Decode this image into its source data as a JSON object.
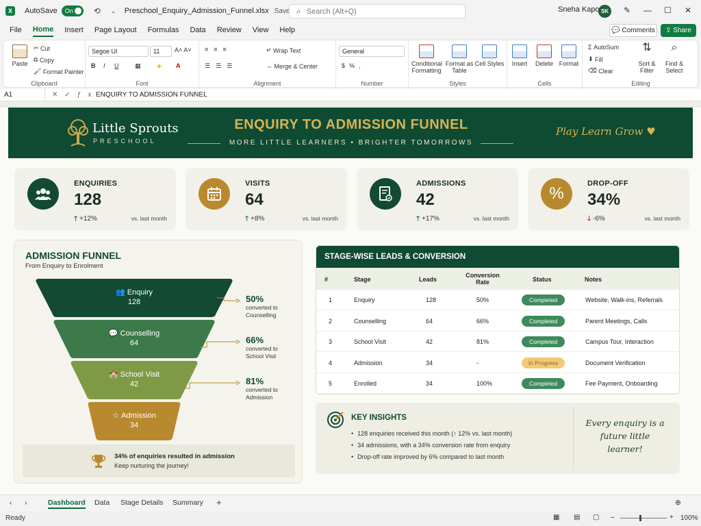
{
  "titlebar": {
    "autosave_label": "AutoSave",
    "autosave_state": "On",
    "filename": "Preschool_Enquiry_Admission_Funnel.xlsx",
    "saved_status": "Saved to OneDrive",
    "search_placeholder": "Search (Alt+Q)",
    "user_name": "Sneha Kapoor",
    "user_initials": "SK"
  },
  "menu": {
    "items": [
      "File",
      "Home",
      "Insert",
      "Page Layout",
      "Formulas",
      "Data",
      "Review",
      "View",
      "Help"
    ],
    "active": "Home",
    "comments_label": "Comments",
    "share_label": "Share"
  },
  "ribbon": {
    "clipboard": {
      "paste": "Paste",
      "cut": "Cut",
      "copy": "Copy",
      "format_painter": "Format Painter",
      "label": "Clipboard"
    },
    "font": {
      "family": "Segoe UI",
      "size": "11",
      "label": "Font"
    },
    "alignment": {
      "wrap": "Wrap Text",
      "merge": "Merge & Center",
      "label": "Alignment"
    },
    "number": {
      "format": "General",
      "label": "Number"
    },
    "styles": {
      "conditional": "Conditional Formatting",
      "table": "Format as Table",
      "cell": "Cell Styles",
      "label": "Styles"
    },
    "cells": {
      "insert": "Insert",
      "delete": "Delete",
      "format": "Format",
      "label": "Cells"
    },
    "editing": {
      "autosum": "AutoSum",
      "fill": "Fill",
      "clear": "Clear",
      "sort": "Sort & Filter",
      "find": "Find & Select",
      "label": "Editing"
    }
  },
  "formula_bar": {
    "cell_ref": "A1",
    "value": "ENQUIRY TO ADMISSION FUNNEL"
  },
  "banner": {
    "brand_name": "Little Sprouts",
    "brand_sub": "PRESCHOOL",
    "title": "ENQUIRY TO ADMISSION FUNNEL",
    "tagline": "MORE LITTLE LEARNERS  •  BRIGHTER TOMORROWS",
    "motto": "Play  Learn  Grow ♥"
  },
  "kpis": [
    {
      "label": "ENQUIRIES",
      "value": "128",
      "arrow": "🡑",
      "delta": "+12%",
      "trend": "up",
      "vs": "vs. last month",
      "icon": "people-icon",
      "color": "#124a33"
    },
    {
      "label": "VISITS",
      "value": "64",
      "arrow": "🡑",
      "delta": "+8%",
      "trend": "up",
      "vs": "vs. last month",
      "icon": "calendar-icon",
      "color": "#b8892e"
    },
    {
      "label": "ADMISSIONS",
      "value": "42",
      "arrow": "🡑",
      "delta": "+17%",
      "trend": "up",
      "vs": "vs. last month",
      "icon": "document-icon",
      "color": "#124a33"
    },
    {
      "label": "DROP-OFF",
      "value": "34%",
      "arrow": "🡓",
      "delta": "-6%",
      "trend": "down",
      "vs": "vs. last month",
      "icon": "percent-icon",
      "color": "#b8892e"
    }
  ],
  "funnel": {
    "title": "ADMISSION FUNNEL",
    "subtitle": "From Enquiry to Enrolment",
    "stages": [
      {
        "name": "Enquiry",
        "count": "128",
        "icon": "people-icon",
        "color": "#124a33"
      },
      {
        "name": "Counselling",
        "count": "64",
        "icon": "chat-icon",
        "color": "#3d7a4a"
      },
      {
        "name": "School Visit",
        "count": "42",
        "icon": "school-icon",
        "color": "#7f9a45"
      },
      {
        "name": "Admission",
        "count": "34",
        "icon": "star-icon",
        "color": "#b8892e"
      }
    ],
    "conversions": [
      {
        "pct": "50%",
        "text1": "converted to",
        "text2": "Counselling"
      },
      {
        "pct": "66%",
        "text1": "converted to",
        "text2": "School Visit"
      },
      {
        "pct": "81%",
        "text1": "converted to",
        "text2": "Admission"
      }
    ],
    "note_line1": "34% of enquiries resulted in admission",
    "note_line2": "Keep nurturing the journey!"
  },
  "stage_table": {
    "title": "STAGE-WISE LEADS & CONVERSION",
    "headers": {
      "num": "#",
      "stage": "Stage",
      "leads": "Leads",
      "conv": "Conversion Rate",
      "status": "Status",
      "notes": "Notes"
    },
    "rows": [
      {
        "num": "1",
        "stage": "Enquiry",
        "leads": "128",
        "conv": "50%",
        "status": "Completed",
        "notes": "Website, Walk-ins, Referrals"
      },
      {
        "num": "2",
        "stage": "Counselling",
        "leads": "64",
        "conv": "66%",
        "status": "Completed",
        "notes": "Parent Meetings, Calls"
      },
      {
        "num": "3",
        "stage": "School Visit",
        "leads": "42",
        "conv": "81%",
        "status": "Completed",
        "notes": "Campus Tour, Interaction"
      },
      {
        "num": "4",
        "stage": "Admission",
        "leads": "34",
        "conv": "-",
        "status": "In Progress",
        "notes": "Document Verification"
      },
      {
        "num": "5",
        "stage": "Enrolled",
        "leads": "34",
        "conv": "100%",
        "status": "Completed",
        "notes": "Fee Payment, Onboarding"
      }
    ]
  },
  "insights": {
    "title": "KEY INSIGHTS",
    "items": [
      "128 enquiries received this month (↑ 12% vs. last month)",
      "34 admissions, with a 34% conversion rate from enquiry",
      "Drop-off rate improved by 6% compared to last month"
    ],
    "quote": "Every enquiry is a future little learner!"
  },
  "sheet_tabs": {
    "items": [
      "Dashboard",
      "Data",
      "Stage Details",
      "Summary"
    ],
    "active": "Dashboard"
  },
  "status": {
    "ready": "Ready",
    "zoom": "100%"
  }
}
